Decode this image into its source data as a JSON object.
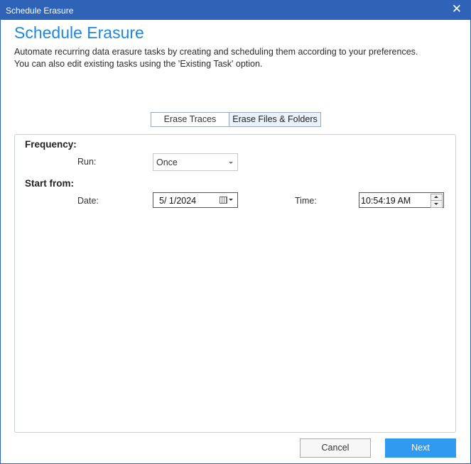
{
  "window": {
    "title": "Schedule Erasure",
    "close_glyph": "✕"
  },
  "header": {
    "heading": "Schedule Erasure",
    "description_line1": "Automate recurring data erasure tasks by creating and scheduling them according to your preferences.",
    "description_line2": "You can also edit existing tasks using the 'Existing Task' option."
  },
  "tabs": [
    {
      "label": "Erase Traces",
      "selected": false
    },
    {
      "label": "Erase Files & Folders",
      "selected": true
    }
  ],
  "form": {
    "frequency_heading": "Frequency:",
    "run_label": "Run:",
    "run_value": "Once",
    "start_heading": "Start from:",
    "date_label": "Date:",
    "date_value": "5/  1/2024",
    "time_label": "Time:",
    "time_value": "10:54:19 AM"
  },
  "buttons": {
    "cancel": "Cancel",
    "next": "Next"
  },
  "colors": {
    "titlebar": "#2e63b8",
    "heading": "#1f87dc",
    "primary_button": "#2f9af0"
  },
  "icons": [
    "close-icon",
    "dropdown-caret-icon",
    "calendar-icon",
    "spin-up-icon",
    "spin-down-icon"
  ]
}
